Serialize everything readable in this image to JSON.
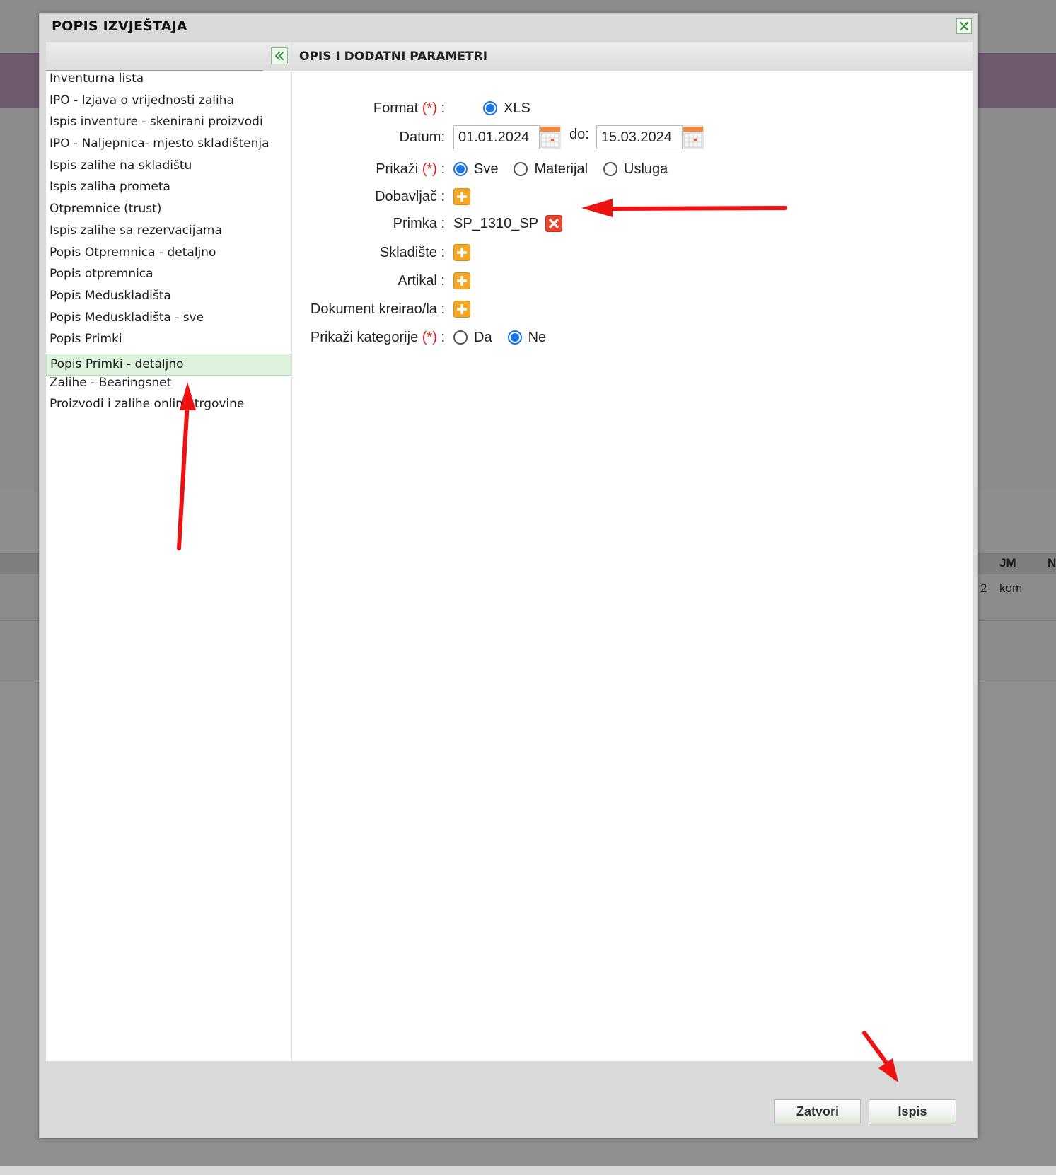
{
  "background": {
    "table_headers": [
      "JM",
      "N"
    ],
    "row_qty": "2",
    "row_unit": "kom"
  },
  "modal": {
    "title": "POPIS IZVJEŠTAJA",
    "close_icon": "close-icon"
  },
  "report_list": {
    "items": [
      "Inventurna lista",
      "IPO - Izjava o vrijednosti zaliha",
      "Ispis inventure - skenirani proizvodi",
      "IPO - Naljepnica- mjesto skladištenja",
      "Ispis zalihe na skladištu",
      "Ispis zaliha prometa",
      "Otpremnice (trust)",
      "Ispis zalihe sa rezervacijama",
      "Popis Otpremnica - detaljno",
      "Popis otpremnica",
      "Popis Međuskladišta",
      "Popis Međuskladišta - sve",
      "Popis Primki",
      "Popis Primki - detaljno",
      "Zalihe - Bearingsnet",
      "Proizvodi i zalihe online trgovine"
    ],
    "selected_index": 13
  },
  "params": {
    "title": "OPIS I DODATNI PARAMETRI",
    "required_mark": "(*)",
    "format": {
      "label": "Format",
      "option": "XLS"
    },
    "datum": {
      "label": "Datum:",
      "from": "01.01.2024",
      "to_label": "do:",
      "to": "15.03.2024"
    },
    "prikazi": {
      "label": "Prikaži",
      "options": [
        "Sve",
        "Materijal",
        "Usluga"
      ],
      "selected": "Sve"
    },
    "dobavljac": {
      "label": "Dobavljač :"
    },
    "primka": {
      "label": "Primka :",
      "value": "SP_1310_SP"
    },
    "skladiste": {
      "label": "Skladište :"
    },
    "artikal": {
      "label": "Artikal :"
    },
    "dokument": {
      "label": "Dokument kreirao/la :"
    },
    "kategorije": {
      "label": "Prikaži kategorije",
      "options": [
        "Da",
        "Ne"
      ],
      "selected": "Ne"
    },
    "colon": ":"
  },
  "footer": {
    "close_label": "Zatvori",
    "print_label": "Ispis"
  },
  "colors": {
    "accent_green": "#8cbf8c",
    "radio_blue": "#1a73e8",
    "required_red": "#e02020",
    "add_orange": "#f5a623",
    "remove_red": "#e8452c",
    "annotation_red": "#ee1111"
  }
}
